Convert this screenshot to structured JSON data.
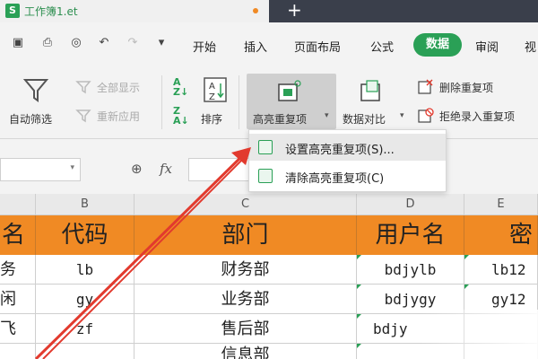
{
  "titlebar": {
    "doc_title": "工作簿1.et",
    "logo": "S"
  },
  "quick_icons": [
    "save-icon",
    "print-icon",
    "print-preview-icon",
    "undo-icon",
    "redo-icon",
    "more-icon"
  ],
  "menu": {
    "items": [
      "开始",
      "插入",
      "页面布局",
      "公式",
      "数据",
      "审阅",
      "视"
    ],
    "active": "数据"
  },
  "ribbon": {
    "auto_filter": "自动筛选",
    "show_all": "全部显示",
    "reapply": "重新应用",
    "sort": "排序",
    "highlight_dup": "高亮重复项",
    "data_compare": "数据对比",
    "delete_dup": "删除重复项",
    "reject_dup": "拒绝录入重复项"
  },
  "dropdown": {
    "items": [
      "设置高亮重复项(S)...",
      "清除高亮重复项(C)"
    ],
    "selected_index": 0
  },
  "formula_bar": {
    "zoom_symbol": "⊕",
    "fx": "fx"
  },
  "columns": [
    "B",
    "C",
    "D",
    "E"
  ],
  "table": {
    "headers": [
      "名",
      "代码",
      "部门",
      "用户名",
      "密"
    ],
    "rows": [
      [
        "务",
        "lb",
        "财务部",
        "bdjylb",
        "lb12"
      ],
      [
        "闲",
        "gy",
        "业务部",
        "bdjygy",
        "gy12"
      ],
      [
        "飞",
        "zf",
        "售后部",
        "bdjy",
        ""
      ],
      [
        "",
        "",
        "信息部",
        "",
        ""
      ]
    ]
  },
  "colors": {
    "accent": "#2aa056",
    "header_fill": "#f08a24",
    "arrow": "#e23a2e"
  }
}
